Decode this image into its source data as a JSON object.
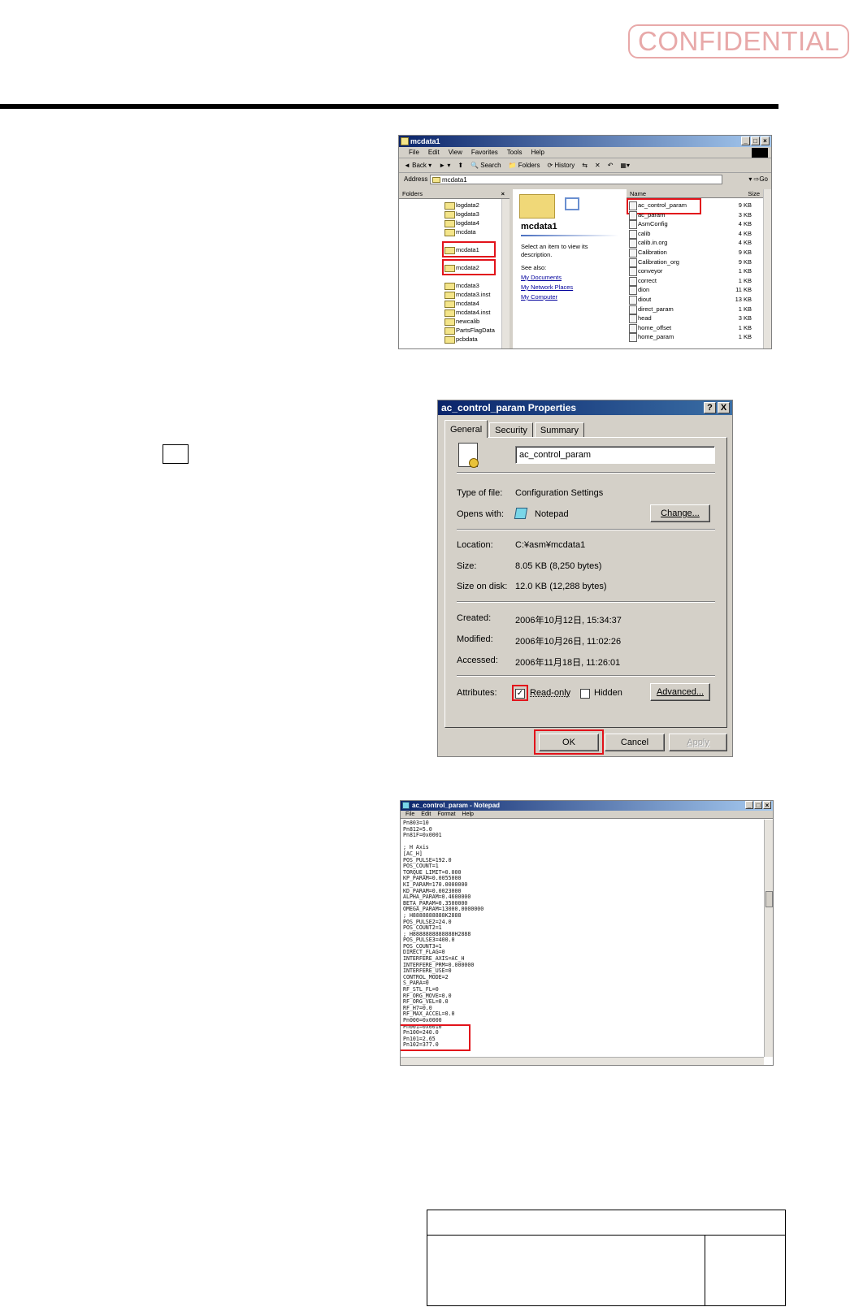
{
  "stamp": "CONFIDENTIAL",
  "explorer": {
    "title": "mcdata1",
    "menu": [
      "File",
      "Edit",
      "View",
      "Favorites",
      "Tools",
      "Help"
    ],
    "toolbar": [
      "Back",
      "Search",
      "Folders",
      "History"
    ],
    "address_label": "Address",
    "address_value": "mcdata1",
    "go_label": "Go",
    "folders_header": "Folders",
    "tree": [
      "logdata2",
      "logdata3",
      "logdata4",
      "mcdata",
      "mcdata1",
      "mcdata2",
      "mcdata3",
      "mcdata3.inst",
      "mcdata4",
      "mcdata4.inst",
      "newcalib",
      "PartsFlagData",
      "pcbdata"
    ],
    "webview_title": "mcdata1",
    "webview_desc": "Select an item to view its description.",
    "see_also": "See also:",
    "links": [
      "My Documents",
      "My Network Places",
      "My Computer"
    ],
    "col_name": "Name",
    "col_size": "Size",
    "files": [
      {
        "name": "ac_control_param",
        "size": "9 KB"
      },
      {
        "name": "ac_param",
        "size": "3 KB"
      },
      {
        "name": "AsmConfig",
        "size": "4 KB"
      },
      {
        "name": "calib",
        "size": "4 KB"
      },
      {
        "name": "calib.in.org",
        "size": "4 KB"
      },
      {
        "name": "Calibration",
        "size": "9 KB"
      },
      {
        "name": "Calibration_org",
        "size": "9 KB"
      },
      {
        "name": "conveyor",
        "size": "1 KB"
      },
      {
        "name": "correct",
        "size": "1 KB"
      },
      {
        "name": "dion",
        "size": "11 KB"
      },
      {
        "name": "diout",
        "size": "13 KB"
      },
      {
        "name": "direct_param",
        "size": "1 KB"
      },
      {
        "name": "head",
        "size": "3 KB"
      },
      {
        "name": "home_offset",
        "size": "1 KB"
      },
      {
        "name": "home_param",
        "size": "1 KB"
      }
    ]
  },
  "dialog": {
    "title": "ac_control_param Properties",
    "help_btn": "?",
    "close_btn": "X",
    "tabs": [
      "General",
      "Security",
      "Summary"
    ],
    "filename": "ac_control_param",
    "type_label": "Type of file:",
    "type_value": "Configuration Settings",
    "opens_label": "Opens with:",
    "opens_value": "Notepad",
    "change_btn": "Change...",
    "location_label": "Location:",
    "location_value": "C:¥asm¥mcdata1",
    "size_label": "Size:",
    "size_value": "8.05 KB (8,250 bytes)",
    "disk_label": "Size on disk:",
    "disk_value": "12.0 KB (12,288 bytes)",
    "created_label": "Created:",
    "created_value": "2006年10月12日, 15:34:37",
    "modified_label": "Modified:",
    "modified_value": "2006年10月26日, 11:02:26",
    "accessed_label": "Accessed:",
    "accessed_value": "2006年11月18日, 11:26:01",
    "attributes_label": "Attributes:",
    "readonly_label": "Read-only",
    "readonly_checked": true,
    "hidden_label": "Hidden",
    "hidden_checked": false,
    "advanced_btn": "Advanced...",
    "ok_btn": "OK",
    "cancel_btn": "Cancel",
    "apply_btn": "Apply"
  },
  "notepad": {
    "title": "ac_control_param - Notepad",
    "menu": [
      "File",
      "Edit",
      "Format",
      "Help"
    ],
    "lines": [
      "Pn803=10",
      "Pn812=5.0",
      "Pn81F=0x0001",
      "",
      "; H Axis",
      "[AC_H]",
      "POS_PULSE=192.0",
      "POS_COUNT=1",
      "TORQUE_LIMIT=0.000",
      "KP_PARAM=0.0055000",
      "KI_PARAM=170.0000000",
      "KD_PARAM=0.0023000",
      "ALPHA_PARAM=0.4600000",
      "BETA_PARAM=0.3500000",
      "OMEGA_PARAM=13000.0000000",
      "; H8888888888K2888",
      "POS_PULSE2=24.0",
      "POS_COUNT2=1",
      "; H8888888888888H2888",
      "POS_PULSE3=400.0",
      "POS_COUNT3=1",
      "DIRECT_FLAG=0",
      "INTERFERE_AXIS=AC_H",
      "INTERFERE_PRM=0.000000",
      "INTERFERE_USE=0",
      "CONTROL_MODE=2",
      "S_PARA=0",
      "RF_STL_FL=0",
      "RF_ORG_MOVE=0.0",
      "RF_ORG_VEL=0.0",
      "RF_H7=0.0",
      "RF_MAX_ACCEL=0.0",
      "Pn000=0x0000",
      "Pn001=0x0010",
      "Pn100=240.0",
      "Pn101=2.65",
      "Pn102=377.0"
    ]
  }
}
